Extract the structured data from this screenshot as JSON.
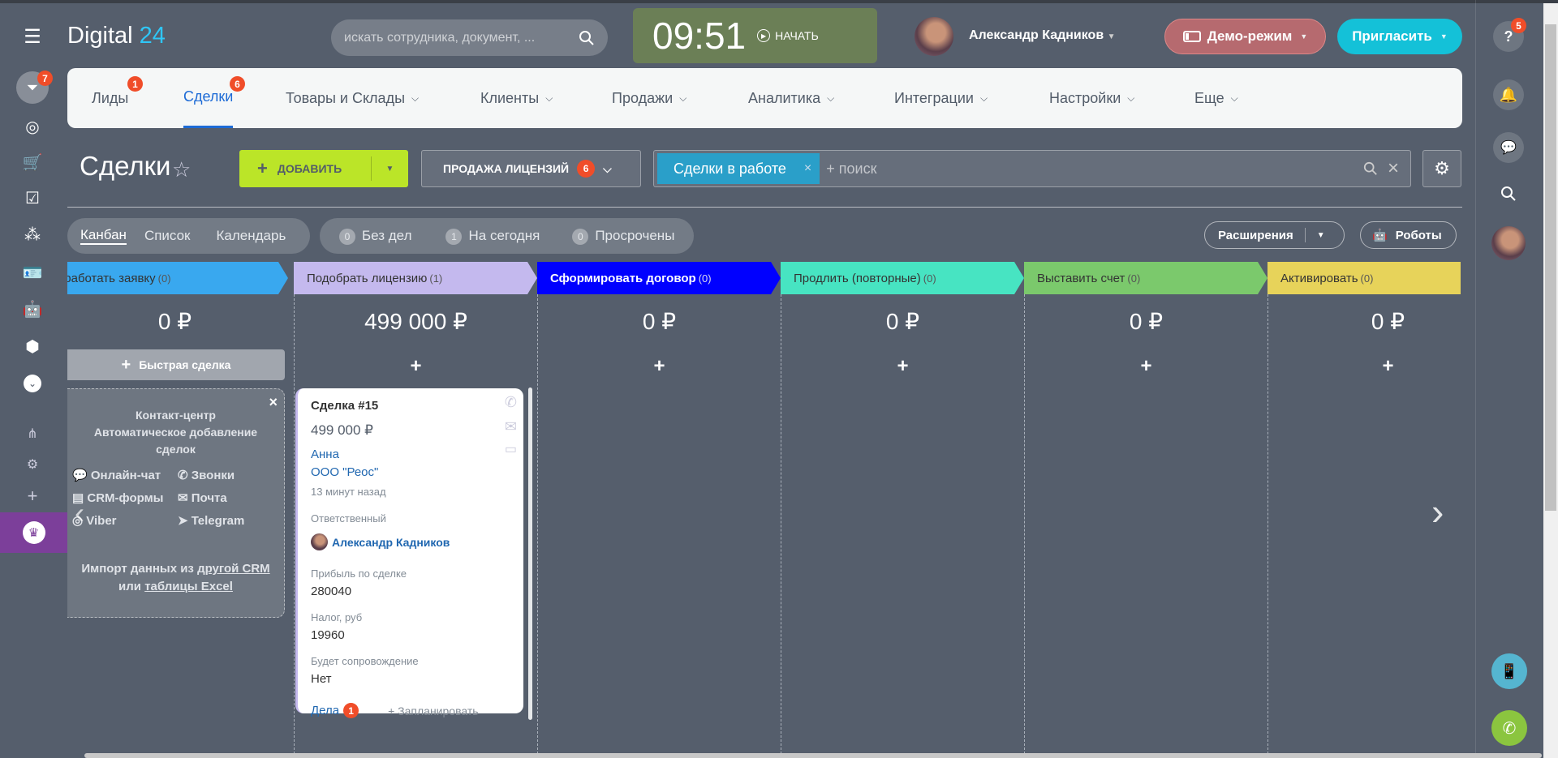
{
  "header": {
    "logo_main": "Digital",
    "logo_accent": "24",
    "search_placeholder": "искать сотрудника, документ, ...",
    "clock": "09:51",
    "start_label": "НАЧАТЬ",
    "user_name": "Александр Кадников",
    "demo_label": "Демо-режим",
    "invite_label": "Пригласить",
    "help_badge": "5"
  },
  "sidebar": {
    "filter_badge": "7"
  },
  "nav": {
    "items": [
      {
        "label": "Лиды",
        "badge": "1"
      },
      {
        "label": "Сделки",
        "badge": "6"
      },
      {
        "label": "Товары и Склады"
      },
      {
        "label": "Клиенты"
      },
      {
        "label": "Продажи"
      },
      {
        "label": "Аналитика"
      },
      {
        "label": "Интеграции"
      },
      {
        "label": "Настройки"
      },
      {
        "label": "Еще"
      }
    ]
  },
  "toolbar": {
    "title": "Сделки",
    "add_label": "ДОБАВИТЬ",
    "pipeline_label": "ПРОДАЖА ЛИЦЕНЗИЙ",
    "pipeline_badge": "6",
    "filter_tag": "Сделки в работе",
    "filter_placeholder": "+ поиск"
  },
  "views": {
    "kanban": "Канбан",
    "list": "Список",
    "calendar": "Календарь"
  },
  "counters": [
    {
      "count": "0",
      "label": "Без дел"
    },
    {
      "count": "1",
      "label": "На сегодня"
    },
    {
      "count": "0",
      "label": "Просрочены"
    }
  ],
  "actions": {
    "extensions": "Расширения",
    "robots": "Роботы"
  },
  "colors": {
    "col0": "#39a8ef",
    "col1": "#c4b9ee",
    "col2": "#0000ff",
    "col3": "#47e4c2",
    "col4": "#7bc96c",
    "col5": "#e7d35a"
  },
  "columns": [
    {
      "title": "Обработать заявку",
      "count": "(0)",
      "sum": "0 ₽"
    },
    {
      "title": "Подобрать лицензию",
      "count": "(1)",
      "sum": "499 000 ₽"
    },
    {
      "title": "Сформировать договор",
      "count": "(0)",
      "sum": "0 ₽"
    },
    {
      "title": "Продлить (повторные)",
      "count": "(0)",
      "sum": "0 ₽"
    },
    {
      "title": "Выставить счет",
      "count": "(0)",
      "sum": "0 ₽"
    },
    {
      "title": "Активировать",
      "count": "(0)",
      "sum": "0 ₽"
    }
  ],
  "quick_deal": "Быстрая сделка",
  "contact_center": {
    "title": "Контакт-центр",
    "subtitle": "Автоматическое добавление сделок",
    "items": [
      "Онлайн-чат",
      "Звонки",
      "CRM-формы",
      "Почта",
      "Viber",
      "Telegram"
    ],
    "import_prefix": "Импорт данных из",
    "import_link1": "другой CRM",
    "import_or": "или",
    "import_link2": "таблицы Excel"
  },
  "card": {
    "title": "Сделка #15",
    "amount": "499 000 ₽",
    "contact": "Анна",
    "company": "ООО \"Реос\"",
    "time": "13 минут назад",
    "responsible_label": "Ответственный",
    "responsible": "Александр Кадников",
    "profit_label": "Прибыль по сделке",
    "profit": "280040",
    "tax_label": "Налог, руб",
    "tax": "19960",
    "support_label": "Будет сопровождение",
    "support": "Нет",
    "tasks_label": "Дела",
    "tasks_badge": "1",
    "plan_label": "+ Запланировать"
  }
}
